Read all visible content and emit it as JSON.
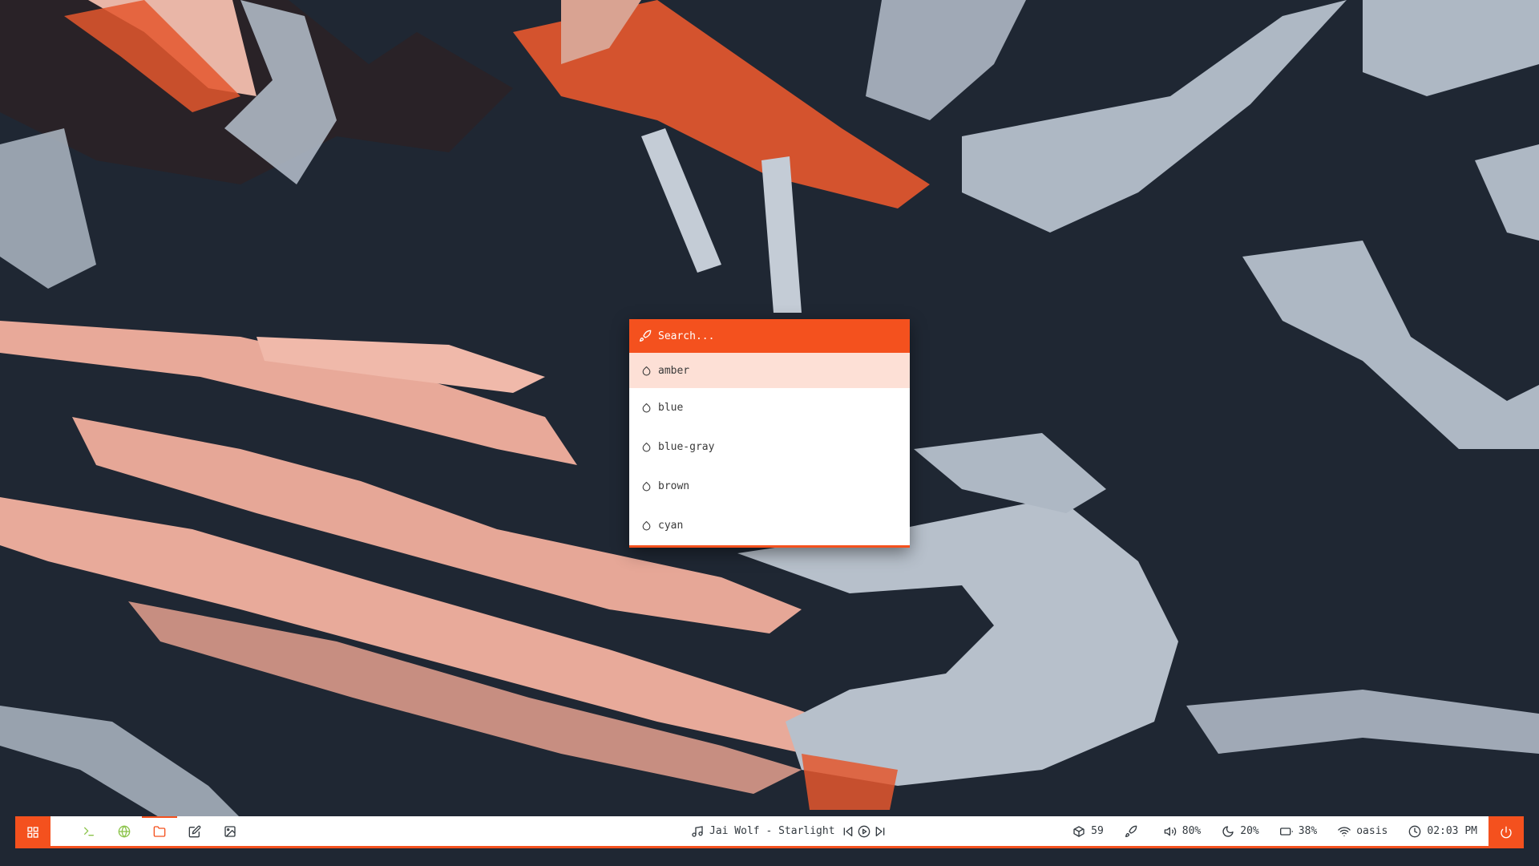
{
  "colors": {
    "accent": "#f4511e",
    "selected_bg": "#fde0d6",
    "bar_bg": "#ffffff",
    "bar_text": "#333a40",
    "terminal_icon": "#8bc34a",
    "browser_icon": "#8bc34a",
    "files_icon": "#f4511e"
  },
  "launcher": {
    "search_icon": "rocket-icon",
    "search_placeholder": "Search...",
    "items": [
      {
        "icon": "drop-icon",
        "label": "amber",
        "selected": true
      },
      {
        "icon": "drop-icon",
        "label": "blue"
      },
      {
        "icon": "drop-icon",
        "label": "blue-gray"
      },
      {
        "icon": "drop-icon",
        "label": "brown"
      },
      {
        "icon": "drop-icon",
        "label": "cyan"
      }
    ]
  },
  "bar": {
    "left_icon": "grid-icon",
    "apps": [
      {
        "icon": "terminal-icon"
      },
      {
        "icon": "globe-icon"
      },
      {
        "icon": "folder-icon",
        "active": true
      },
      {
        "icon": "edit-icon"
      },
      {
        "icon": "image-icon"
      }
    ],
    "media": {
      "icon": "music-note-icon",
      "title": "Jai Wolf - Starlight",
      "controls": [
        "skip-back-icon",
        "play-icon",
        "skip-forward-icon"
      ]
    },
    "status": {
      "packages": {
        "icon": "package-icon",
        "value": "59"
      },
      "theme": {
        "icon": "rocket-icon"
      },
      "volume": {
        "icon": "volume-icon",
        "value": "80%"
      },
      "brightness": {
        "icon": "moon-icon",
        "value": "20%"
      },
      "battery": {
        "icon": "battery-icon",
        "value": "38%"
      },
      "wifi": {
        "icon": "wifi-icon",
        "value": "oasis"
      },
      "clock": {
        "icon": "clock-icon",
        "value": "02:03 PM"
      }
    },
    "right_icon": "power-icon"
  }
}
